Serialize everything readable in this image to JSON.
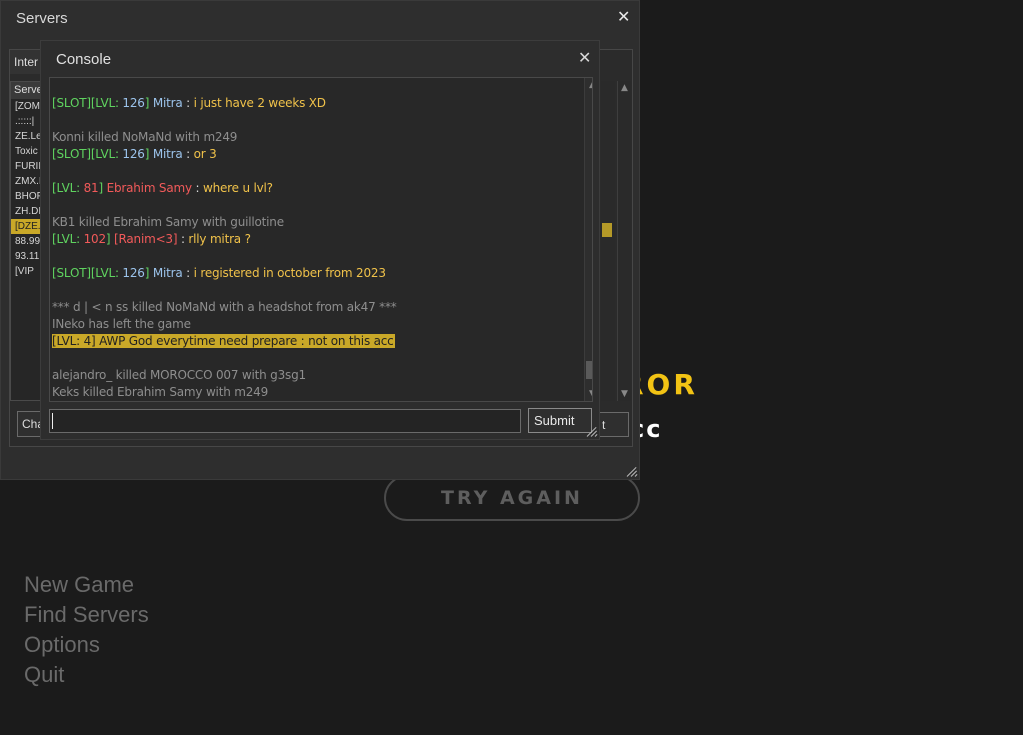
{
  "background": {
    "error_word": "ROR",
    "error_sub": "cc",
    "try_again_label": "TRY AGAIN",
    "menu": [
      "New Game",
      "Find Servers",
      "Options",
      "Quit"
    ]
  },
  "servers_window": {
    "title": "Servers",
    "tab_label": "Inter",
    "list_header": "Serve",
    "rows": [
      "[ZOM",
      ".:::::|",
      "ZE.Le",
      "Toxic",
      "FURII",
      "ZMX.I",
      "BHOP",
      "ZH.DI",
      "[DZE.",
      "88.99",
      "93.11",
      "[VIP"
    ],
    "selected_row": 8,
    "left_button_label": "Cha",
    "right_button_label": "t"
  },
  "console_window": {
    "title": "Console",
    "input_value": "",
    "submit_label": "Submit",
    "lines": [
      {
        "segs": [
          {
            "t": "[SLOT][LVL: ",
            "c": "g"
          },
          {
            "t": "126",
            "c": "b"
          },
          {
            "t": "] ",
            "c": "g"
          },
          {
            "t": "Mitra",
            "c": "b"
          },
          {
            "t": " : ",
            "c": "w"
          },
          {
            "t": "i just have 2 weeks XD",
            "c": "y"
          }
        ]
      },
      {
        "segs": []
      },
      {
        "segs": [
          {
            "t": "Konni killed NoMaNd with m249",
            "c": "gr"
          }
        ]
      },
      {
        "segs": [
          {
            "t": "[SLOT][LVL: ",
            "c": "g"
          },
          {
            "t": "126",
            "c": "b"
          },
          {
            "t": "] ",
            "c": "g"
          },
          {
            "t": "Mitra",
            "c": "b"
          },
          {
            "t": " : ",
            "c": "w"
          },
          {
            "t": "or 3",
            "c": "y"
          }
        ]
      },
      {
        "segs": []
      },
      {
        "segs": [
          {
            "t": "[LVL: ",
            "c": "g"
          },
          {
            "t": "81",
            "c": "r"
          },
          {
            "t": "] ",
            "c": "g"
          },
          {
            "t": "Ebrahim Samy",
            "c": "r"
          },
          {
            "t": "  : ",
            "c": "w"
          },
          {
            "t": "where u lvl?",
            "c": "y"
          }
        ]
      },
      {
        "segs": []
      },
      {
        "segs": [
          {
            "t": "KB1 killed Ebrahim Samy with guillotine",
            "c": "gr"
          }
        ]
      },
      {
        "segs": [
          {
            "t": "[LVL: ",
            "c": "g"
          },
          {
            "t": "102",
            "c": "r"
          },
          {
            "t": "] ",
            "c": "g"
          },
          {
            "t": "[Ranim<3]",
            "c": "r"
          },
          {
            "t": " : ",
            "c": "w"
          },
          {
            "t": "rlly mitra ?",
            "c": "y"
          }
        ]
      },
      {
        "segs": []
      },
      {
        "segs": [
          {
            "t": "[SLOT][LVL: ",
            "c": "g"
          },
          {
            "t": "126",
            "c": "b"
          },
          {
            "t": "] ",
            "c": "g"
          },
          {
            "t": "Mitra",
            "c": "b"
          },
          {
            "t": " : ",
            "c": "w"
          },
          {
            "t": "i registered in october from 2023",
            "c": "y"
          }
        ]
      },
      {
        "segs": []
      },
      {
        "segs": [
          {
            "t": "*** d | < n ss killed NoMaNd with a headshot from ak47 ***",
            "c": "gr"
          }
        ]
      },
      {
        "segs": [
          {
            "t": "INeko has left the game",
            "c": "gr"
          }
        ]
      },
      {
        "segs": [
          {
            "t": "[LVL: 4] AWP God everytime need prepare : not on this acc",
            "c": "hl"
          }
        ]
      },
      {
        "segs": []
      },
      {
        "segs": [
          {
            "t": "alejandro_ killed MOROCCO 007 with g3sg1",
            "c": "gr"
          }
        ]
      },
      {
        "segs": [
          {
            "t": "Keks killed Ebrahim Samy with m249",
            "c": "gr"
          }
        ]
      }
    ]
  }
}
